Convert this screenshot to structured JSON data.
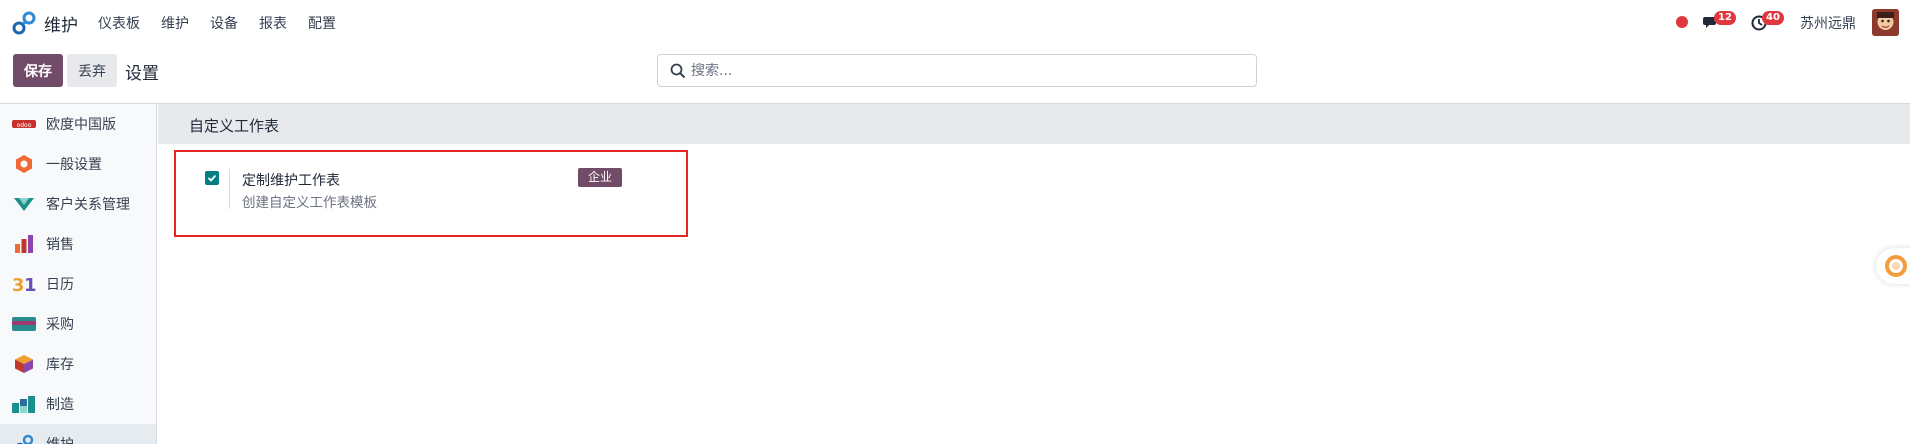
{
  "navbar": {
    "app_name": "维护",
    "menu": [
      "仪表板",
      "维护",
      "设备",
      "报表",
      "配置"
    ],
    "chat_count": "12",
    "activity_count": "40",
    "company": "苏州远鼎"
  },
  "control": {
    "save_label": "保存",
    "discard_label": "丢弃",
    "title": "设置",
    "search_placeholder": "搜索..."
  },
  "sidebar": {
    "items": [
      {
        "label": "欧度中国版",
        "icon": "odoo-china-icon"
      },
      {
        "label": "一般设置",
        "icon": "general-settings-icon"
      },
      {
        "label": "客户关系管理",
        "icon": "crm-icon"
      },
      {
        "label": "销售",
        "icon": "sales-icon"
      },
      {
        "label": "日历",
        "icon": "calendar-icon"
      },
      {
        "label": "采购",
        "icon": "purchase-icon"
      },
      {
        "label": "库存",
        "icon": "inventory-icon"
      },
      {
        "label": "制造",
        "icon": "manufacturing-icon"
      },
      {
        "label": "维护",
        "icon": "maintenance-icon"
      }
    ]
  },
  "section": {
    "title": "自定义工作表",
    "setting": {
      "title": "定制维护工作表",
      "description": "创建自定义工作表模板",
      "badge": "企业",
      "checked": true
    }
  },
  "colors": {
    "brand": "#714b67",
    "check": "#017e84",
    "badge_red": "#e0373f",
    "highlight": "#e32525"
  }
}
